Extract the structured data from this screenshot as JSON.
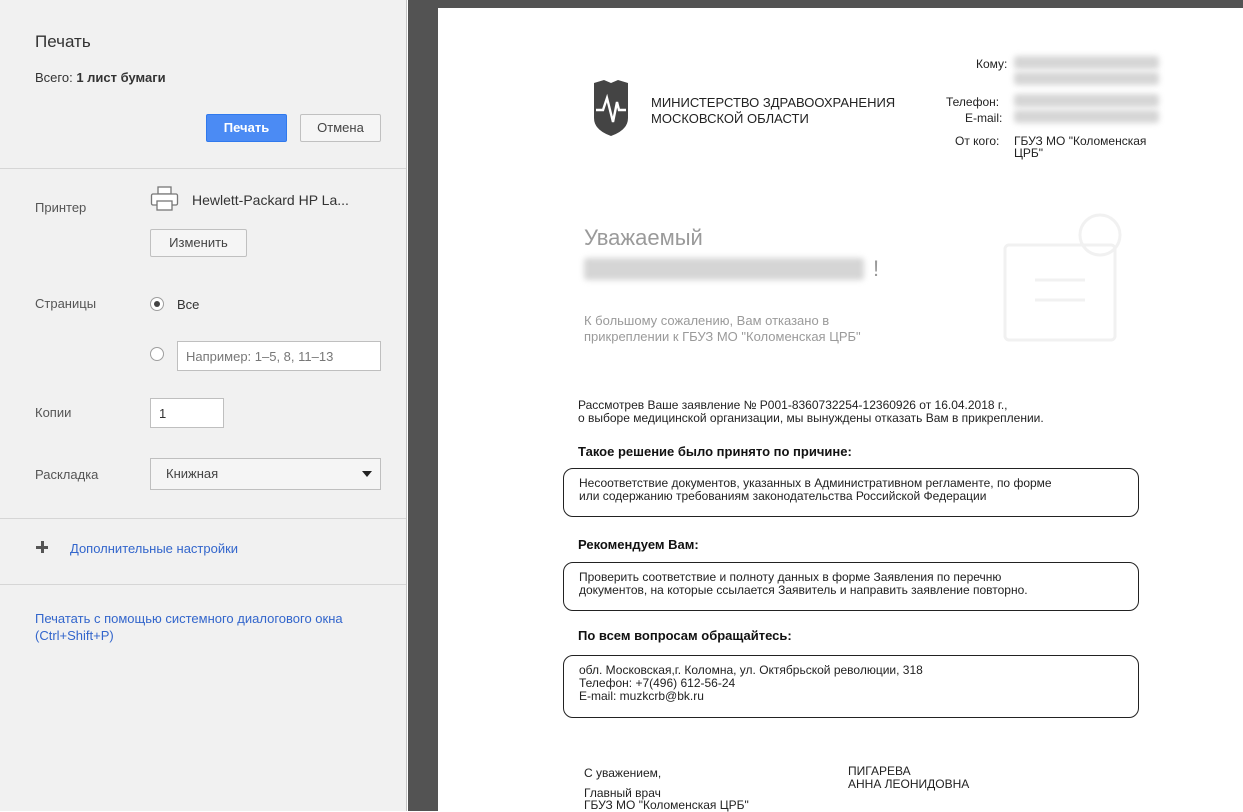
{
  "sidebar": {
    "title": "Печать",
    "summary_prefix": "Всего:",
    "summary_value": "1 лист бумаги",
    "print_label": "Печать",
    "cancel_label": "Отмена",
    "printer_label": "Принтер",
    "printer_name": "Hewlett-Packard HP La...",
    "change_label": "Изменить",
    "pages_label": "Страницы",
    "pages_all_label": "Все",
    "pages_placeholder": "Например: 1–5, 8, 11–13",
    "copies_label": "Копии",
    "copies_value": "1",
    "layout_label": "Раскладка",
    "layout_value": "Книжная",
    "more_settings": "Дополнительные настройки",
    "system_dialog": "Печатать с помощью системного диалогового окна (Ctrl+Shift+P)"
  },
  "document": {
    "to_label": "Кому:",
    "phone_label": "Телефон:",
    "email_label": "E-mail:",
    "from_label": "От кого:",
    "from_value_1": "ГБУЗ МО \"Коломенская",
    "from_value_2": "ЦРБ\"",
    "ministry_line1": "МИНИСТЕРСТВО ЗДРАВООХРАНЕНИЯ",
    "ministry_line2": "МОСКОВСКОЙ ОБЛАСТИ",
    "greeting": "Уважаемый",
    "greeting_end": "!",
    "refused_line1": "К большому сожалению, Вам отказано в",
    "refused_line2": "прикреплении к ГБУЗ МО \"Коломенская ЦРБ\"",
    "body_line1": "Рассмотрев Ваше заявление № Р001-8360732254-12360926 от 16.04.2018 г.,",
    "body_line2": "о выборе медицинской организации, мы вынуждены отказать Вам в прикреплении.",
    "reason_heading": "Такое решение было принято по причине:",
    "reason_line1": "Несоответствие документов, указанных в Административном регламенте, по форме",
    "reason_line2": "или содержанию требованиям законодательства Российской Федерации",
    "recommend_heading": "Рекомендуем Вам:",
    "recommend_line1": "Проверить соответствие и полноту данных в форме Заявления по перечню",
    "recommend_line2": "документов, на которые ссылается Заявитель и направить заявление повторно.",
    "contact_heading": "По всем вопросам обращайтесь:",
    "contact_line1": "обл. Московская,г. Коломна, ул. Октябрьской революции, 318",
    "contact_line2": "Телефон: +7(496) 612-56-24",
    "contact_line3": "E-mail: muzkcrb@bk.ru",
    "regards": "С уважением,",
    "position": "Главный врач",
    "org": "ГБУЗ МО \"Коломенская ЦРБ\"",
    "surname": "ПИГАРЕВА",
    "name": "АННА ЛЕОНИДОВНА"
  },
  "colors": {
    "accent": "#4b8bf4",
    "link": "#3366cc",
    "preview_bg": "#535353"
  }
}
